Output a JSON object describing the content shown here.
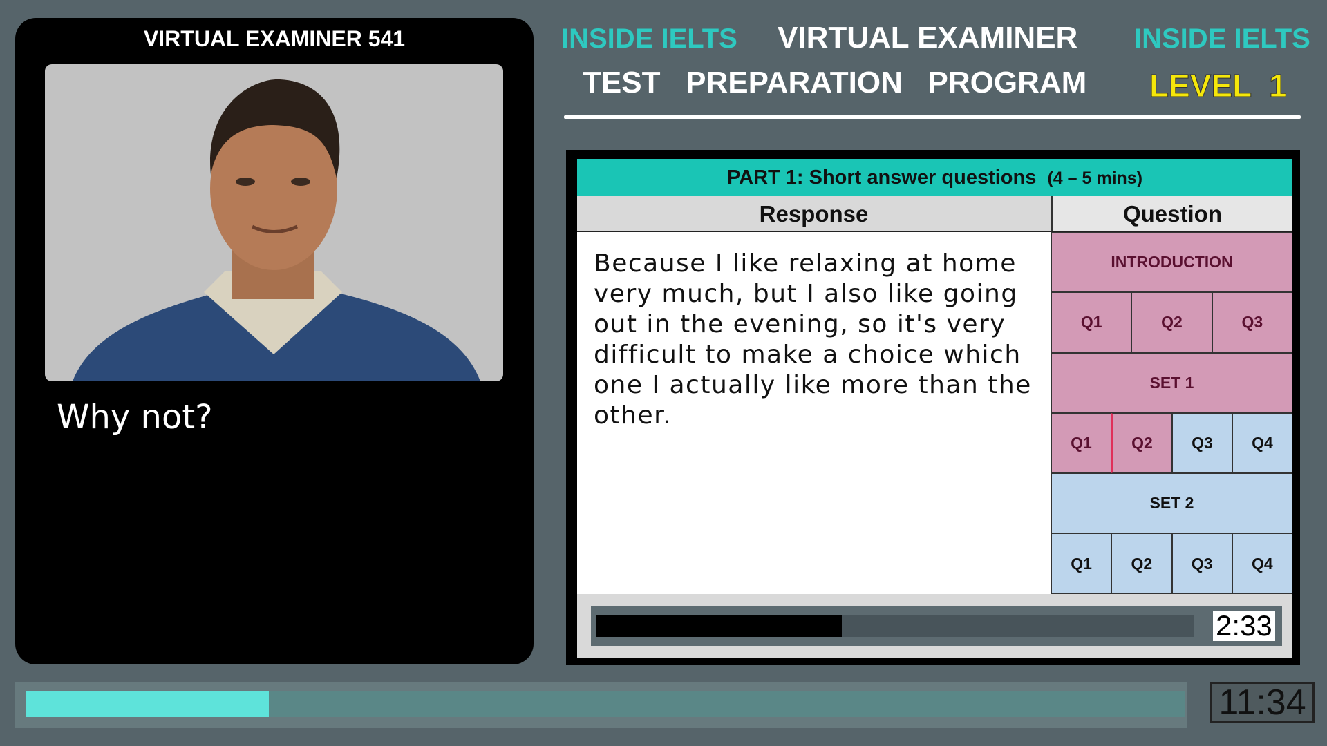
{
  "left_panel": {
    "title": "VIRTUAL EXAMINER  541",
    "caption": "Why not?"
  },
  "header": {
    "brand_left": "INSIDE IELTS",
    "brand_right": "INSIDE IELTS",
    "title_line1": "VIRTUAL  EXAMINER",
    "title_line2": "TEST   PREPARATION   PROGRAM",
    "level": "LEVEL  1"
  },
  "card": {
    "part_title": "PART 1: Short answer questions",
    "part_duration": "(4 – 5 mins)",
    "response_header": "Response",
    "question_header": "Question",
    "response_text": "Because I like relaxing at home very much, but I also like going out in the evening, so it's very difficult to make a choice which one I actually like more than the other.",
    "grid": {
      "intro": "INTRODUCTION",
      "intro_qs": [
        "Q1",
        "Q2",
        "Q3"
      ],
      "set1": "SET 1",
      "set1_qs": [
        "Q1",
        "Q2",
        "Q3",
        "Q4"
      ],
      "set2": "SET 2",
      "set2_qs": [
        "Q1",
        "Q2",
        "Q3",
        "Q4"
      ]
    },
    "answer_timer": "2:33",
    "answer_progress": 0.41
  },
  "colors": {
    "done": "#d39ab6",
    "pending": "#bcd5ec",
    "accent": "#1ac5b5"
  },
  "main_timer": "11:34",
  "main_progress": 0.21
}
